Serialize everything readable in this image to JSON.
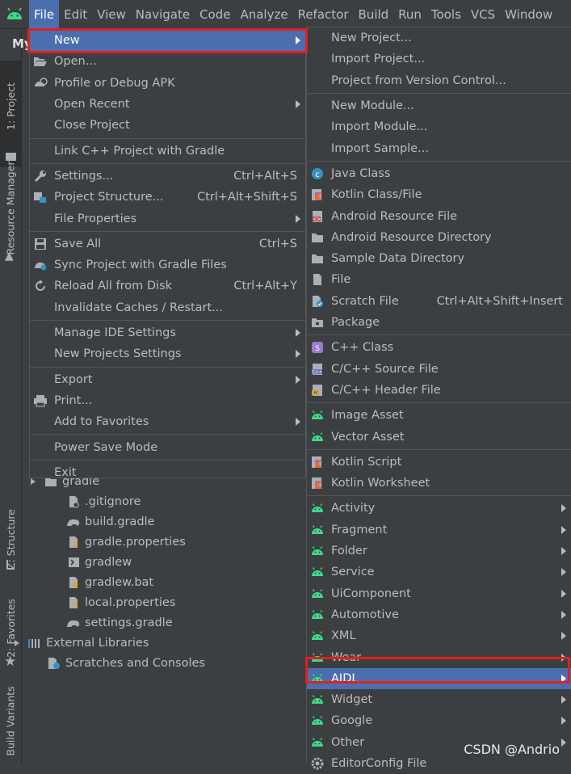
{
  "menubar": {
    "items": [
      "File",
      "Edit",
      "View",
      "Navigate",
      "Code",
      "Analyze",
      "Refactor",
      "Build",
      "Run",
      "Tools",
      "VCS",
      "Window"
    ],
    "active_index": 0
  },
  "left_tabs": {
    "project": "1: Project",
    "resource_manager": "Resource Manager",
    "structure": "Z: Structure",
    "favorites": "2: Favorites",
    "build_variants": "Build Variants"
  },
  "project_panel_title_fragment": "My",
  "tree": [
    {
      "label": "gradle",
      "icon": "folder-icon",
      "chevron": true
    },
    {
      "label": ".gitignore",
      "icon": "ignore-file-icon"
    },
    {
      "label": "build.gradle",
      "icon": "gradle-elephant-icon"
    },
    {
      "label": "gradle.properties",
      "icon": "properties-file-icon"
    },
    {
      "label": "gradlew",
      "icon": "shell-script-icon"
    },
    {
      "label": "gradlew.bat",
      "icon": "batch-file-icon"
    },
    {
      "label": "local.properties",
      "icon": "properties-file-icon"
    },
    {
      "label": "settings.gradle",
      "icon": "gradle-elephant-icon"
    },
    {
      "label": "External Libraries",
      "icon": "libraries-icon",
      "chevron": true
    },
    {
      "label": "Scratches and Consoles",
      "icon": "scratches-icon"
    }
  ],
  "file_menu": [
    {
      "label": "New",
      "submenu": true,
      "highlighted": true
    },
    {
      "label": "Open...",
      "icon": "folder-open-icon"
    },
    {
      "label": "Profile or Debug APK",
      "icon": "profile-apk-icon"
    },
    {
      "label": "Open Recent",
      "submenu": true
    },
    {
      "label": "Close Project"
    },
    {
      "separator": true
    },
    {
      "label": "Link C++ Project with Gradle"
    },
    {
      "separator": true
    },
    {
      "label": "Settings...",
      "icon": "wrench-icon",
      "shortcut": "Ctrl+Alt+S"
    },
    {
      "label": "Project Structure...",
      "icon": "project-structure-icon",
      "shortcut": "Ctrl+Alt+Shift+S"
    },
    {
      "label": "File Properties",
      "submenu": true
    },
    {
      "separator": true
    },
    {
      "label": "Save All",
      "icon": "save-icon",
      "shortcut": "Ctrl+S"
    },
    {
      "label": "Sync Project with Gradle Files",
      "icon": "gradle-sync-icon"
    },
    {
      "label": "Reload All from Disk",
      "icon": "reload-icon",
      "shortcut": "Ctrl+Alt+Y"
    },
    {
      "label": "Invalidate Caches / Restart..."
    },
    {
      "separator": true
    },
    {
      "label": "Manage IDE Settings",
      "submenu": true
    },
    {
      "label": "New Projects Settings",
      "submenu": true
    },
    {
      "separator": true
    },
    {
      "label": "Export",
      "submenu": true
    },
    {
      "label": "Print...",
      "icon": "printer-icon"
    },
    {
      "label": "Add to Favorites",
      "submenu": true
    },
    {
      "separator": true
    },
    {
      "label": "Power Save Mode"
    },
    {
      "separator": true
    },
    {
      "label": "Exit"
    }
  ],
  "new_menu": [
    {
      "label": "New Project..."
    },
    {
      "label": "Import Project..."
    },
    {
      "label": "Project from Version Control..."
    },
    {
      "separator": true
    },
    {
      "label": "New Module..."
    },
    {
      "label": "Import Module..."
    },
    {
      "label": "Import Sample..."
    },
    {
      "separator": true
    },
    {
      "label": "Java Class",
      "icon": "java-class-icon"
    },
    {
      "label": "Kotlin Class/File",
      "icon": "kotlin-file-icon"
    },
    {
      "label": "Android Resource File",
      "icon": "android-resource-file-icon"
    },
    {
      "label": "Android Resource Directory",
      "icon": "folder-icon"
    },
    {
      "label": "Sample Data Directory",
      "icon": "folder-icon"
    },
    {
      "label": "File",
      "icon": "file-icon"
    },
    {
      "label": "Scratch File",
      "icon": "scratch-file-icon",
      "shortcut": "Ctrl+Alt+Shift+Insert"
    },
    {
      "label": "Package",
      "icon": "package-icon"
    },
    {
      "separator": true
    },
    {
      "label": "C++ Class",
      "icon": "cpp-class-icon"
    },
    {
      "label": "C/C++ Source File",
      "icon": "cpp-source-icon"
    },
    {
      "label": "C/C++ Header File",
      "icon": "cpp-header-icon"
    },
    {
      "separator": true
    },
    {
      "label": "Image Asset",
      "icon": "android-icon"
    },
    {
      "label": "Vector Asset",
      "icon": "android-icon"
    },
    {
      "separator": true
    },
    {
      "label": "Kotlin Script",
      "icon": "kotlin-file-icon"
    },
    {
      "label": "Kotlin Worksheet",
      "icon": "kotlin-file-icon"
    },
    {
      "separator": true
    },
    {
      "label": "Activity",
      "icon": "android-icon",
      "submenu": true
    },
    {
      "label": "Fragment",
      "icon": "android-icon",
      "submenu": true
    },
    {
      "label": "Folder",
      "icon": "android-icon",
      "submenu": true
    },
    {
      "label": "Service",
      "icon": "android-icon",
      "submenu": true
    },
    {
      "label": "UiComponent",
      "icon": "android-icon",
      "submenu": true
    },
    {
      "label": "Automotive",
      "icon": "android-icon",
      "submenu": true
    },
    {
      "label": "XML",
      "icon": "android-icon",
      "submenu": true
    },
    {
      "label": "Wear",
      "icon": "android-icon",
      "submenu": true
    },
    {
      "label": "AIDL",
      "icon": "android-icon",
      "submenu": true,
      "highlighted": true
    },
    {
      "label": "Widget",
      "icon": "android-icon",
      "submenu": true
    },
    {
      "label": "Google",
      "icon": "android-icon",
      "submenu": true
    },
    {
      "label": "Other",
      "icon": "android-icon",
      "submenu": true
    },
    {
      "label": "EditorConfig File",
      "icon": "gear-icon"
    }
  ],
  "watermark": "CSDN @Andrio",
  "colors": {
    "background": "#3c3f41",
    "highlight": "#4b6eaf",
    "annotation_red": "#e02020",
    "android_green": "#3ddc84"
  }
}
